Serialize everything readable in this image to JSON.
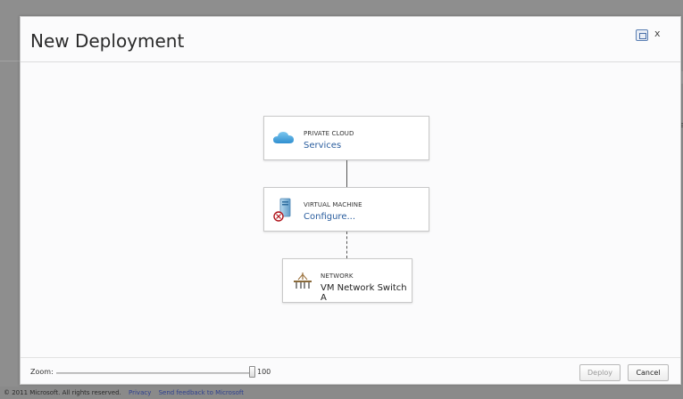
{
  "dialog": {
    "title": "New Deployment",
    "restore_icon": "restore-window-icon",
    "close_label": "x"
  },
  "nodes": [
    {
      "type_label": "PRIVATE CLOUD",
      "value": "Services",
      "icon": "cloud-icon",
      "value_color": "#2a5d9e"
    },
    {
      "type_label": "VIRTUAL MACHINE",
      "value": "Configure...",
      "icon": "server-error-icon",
      "value_color": "#2a5d9e"
    },
    {
      "type_label": "NETWORK",
      "value": "VM Network Switch A",
      "icon": "network-switch-icon",
      "value_color": "#222222"
    }
  ],
  "connectors": [
    {
      "style": "solid"
    },
    {
      "style": "dashed"
    }
  ],
  "zoom": {
    "label": "Zoom:",
    "value": "100"
  },
  "buttons": {
    "deploy": "Deploy",
    "cancel": "Cancel"
  },
  "footer": {
    "copyright": "© 2011 Microsoft. All rights reserved.",
    "privacy": "Privacy",
    "feedback": "Send feedback to Microsoft"
  },
  "backdrop": {
    "right_text": "eas"
  }
}
